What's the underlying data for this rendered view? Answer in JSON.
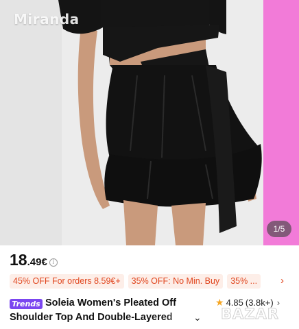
{
  "gallery": {
    "watermark": "Miranda",
    "counter": "1/5"
  },
  "price": {
    "integer": "18",
    "decimal": ".49€",
    "info_icon": "info-icon"
  },
  "promos": [
    {
      "label": "45% OFF For orders 8.59€+"
    },
    {
      "label": "35% OFF: No Min. Buy"
    },
    {
      "label": "35%  ..."
    }
  ],
  "promo_more_icon": "chevron-right-icon",
  "product": {
    "badge": "Trends",
    "title_line1": "Soleia Women's Pleated Off",
    "title_line2": "Shoulder Top And Double-Layered",
    "expand_icon": "chevron-down-icon"
  },
  "rating": {
    "star_icon": "star-icon",
    "value": "4.85",
    "count": "(3.8k+)"
  },
  "site_watermark": "BAZAR",
  "colors": {
    "accent": "#e0441c",
    "chip_bg": "#fdeee8",
    "trends_badge": "#7b46f0",
    "star": "#f5a623",
    "pink_backdrop": "#f27bd8"
  }
}
